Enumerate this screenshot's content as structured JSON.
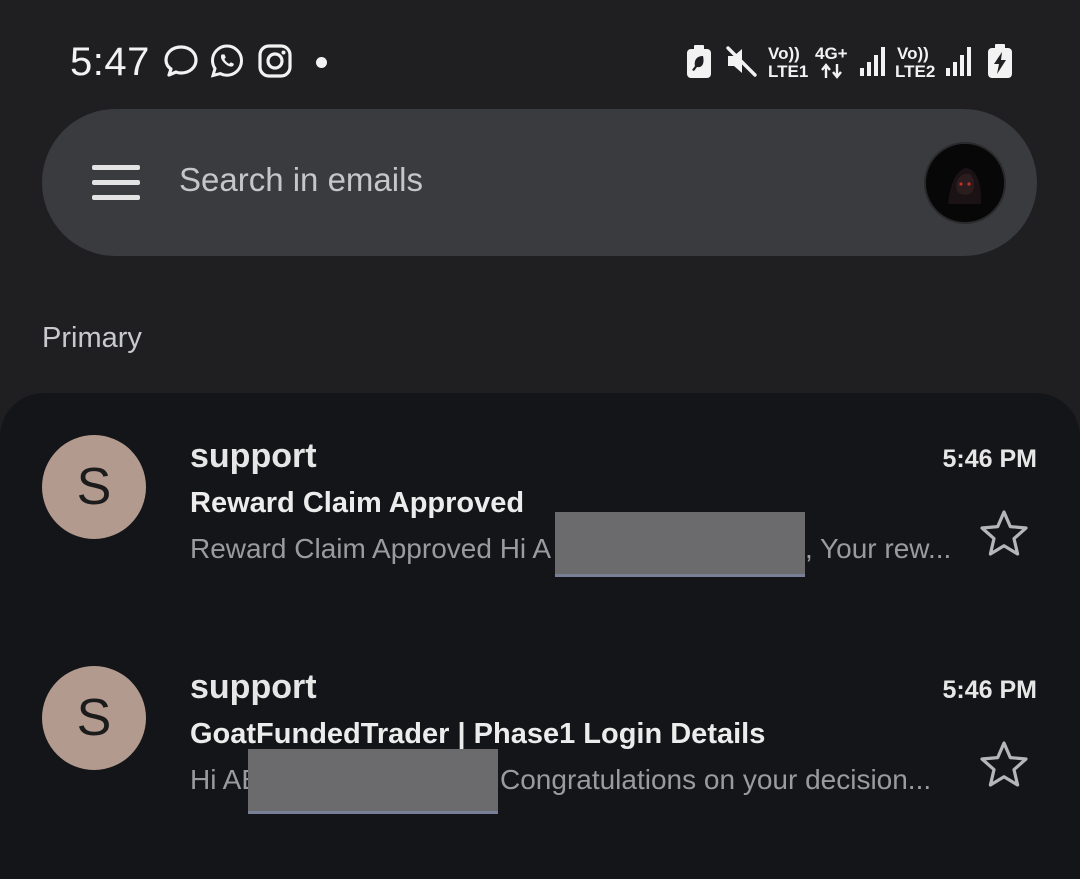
{
  "status_bar": {
    "time": "5:47",
    "sim1_volte": "Vo))",
    "sim1_label": "LTE1",
    "network_type": "4G+",
    "sim2_volte": "Vo))",
    "sim2_label": "LTE2",
    "icons_left": [
      "messages-icon",
      "whatsapp-icon",
      "instagram-icon",
      "notification-dot"
    ],
    "icons_right": [
      "battery-saver-icon",
      "mute-icon",
      "signal-icon",
      "battery-charging-icon"
    ]
  },
  "search": {
    "placeholder": "Search in emails"
  },
  "section": {
    "label": "Primary"
  },
  "emails": [
    {
      "avatar_letter": "S",
      "sender": "support",
      "time": "5:46 PM",
      "subject": "Reward Claim Approved",
      "snippet_start": "Reward Claim Approved Hi A",
      "snippet_end": ", Your rew...",
      "starred": false
    },
    {
      "avatar_letter": "S",
      "sender": "support",
      "time": "5:46 PM",
      "subject": "GoatFundedTrader | Phase1 Login Details",
      "snippet_start": "Hi AE",
      "snippet_end": "Congratulations on your decision...",
      "starred": false
    }
  ],
  "colors": {
    "background": "#1f1f22",
    "search_bar": "#3a3b3e",
    "list_background": "#141518",
    "avatar": "#b39a8f",
    "redaction": "#6b6b6e"
  }
}
